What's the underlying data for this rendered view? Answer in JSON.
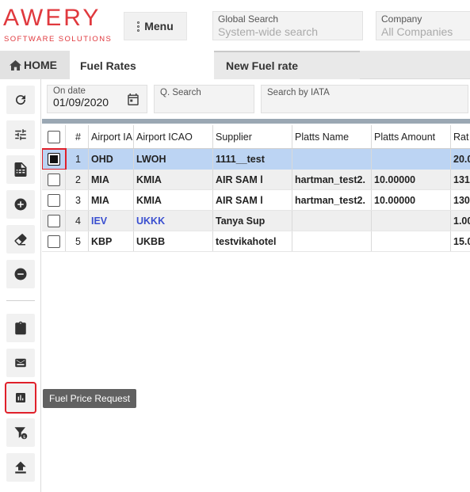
{
  "logo": {
    "main": "AWERY",
    "sub": "SOFTWARE SOLUTIONS"
  },
  "header": {
    "menu_label": "Menu",
    "global_search": {
      "label": "Global Search",
      "placeholder": "System-wide search"
    },
    "company": {
      "label": "Company",
      "placeholder": "All Companies"
    }
  },
  "tabs": [
    {
      "label": "HOME",
      "icon": "home-icon"
    },
    {
      "label": "Fuel Rates"
    },
    {
      "label": "New Fuel rate"
    }
  ],
  "sidebar": {
    "buttons": [
      {
        "name": "refresh",
        "icon": "refresh-icon"
      },
      {
        "name": "filters",
        "icon": "tune-icon"
      },
      {
        "name": "export",
        "icon": "spreadsheet-icon"
      },
      {
        "name": "add",
        "icon": "plus-circle-icon"
      },
      {
        "name": "clear",
        "icon": "eraser-icon"
      },
      {
        "name": "remove",
        "icon": "minus-circle-icon"
      },
      {
        "name": "clipboard",
        "icon": "clipboard-icon"
      },
      {
        "name": "email",
        "icon": "email-icon"
      },
      {
        "name": "fuel-price-request",
        "icon": "bar-chart-icon"
      },
      {
        "name": "filter-currency",
        "icon": "filter-dollar-icon"
      },
      {
        "name": "upload",
        "icon": "upload-icon"
      }
    ],
    "tooltip": "Fuel Price Request"
  },
  "filters": {
    "on_date": {
      "label": "On date",
      "value": "01/09/2020"
    },
    "q_search": {
      "placeholder": "Q. Search"
    },
    "iata_search": {
      "placeholder": "Search by IATA"
    }
  },
  "table": {
    "columns": [
      "#",
      "Airport IATA",
      "Airport ICAO",
      "Supplier",
      "Platts Name",
      "Platts Amount",
      "Rate"
    ],
    "header_display": [
      "#",
      "Airport IA",
      "Airport ICAO",
      "Supplier",
      "Platts Name",
      "Platts Amount",
      "Rat"
    ],
    "rows": [
      {
        "num": "1",
        "iata": "OHD",
        "icao": "LWOH",
        "supplier": "1111__test",
        "platts_name": "",
        "platts_amount": "",
        "rate": "20.0",
        "checked": true,
        "selected": true
      },
      {
        "num": "2",
        "iata": "MIA",
        "icao": "KMIA",
        "supplier": "AIR SAM l",
        "platts_name": "hartman_test2.",
        "platts_amount": "10.00000",
        "rate": "131",
        "checked": false,
        "selected": false
      },
      {
        "num": "3",
        "iata": "MIA",
        "icao": "KMIA",
        "supplier": "AIR SAM l",
        "platts_name": "hartman_test2.",
        "platts_amount": "10.00000",
        "rate": "130",
        "checked": false,
        "selected": false
      },
      {
        "num": "4",
        "iata": "IEV",
        "icao": "UKKK",
        "supplier": "Tanya Sup",
        "platts_name": "",
        "platts_amount": "",
        "rate": "1.00",
        "checked": false,
        "selected": false,
        "link": true
      },
      {
        "num": "5",
        "iata": "KBP",
        "icao": "UKBB",
        "supplier": "testvikahotel",
        "platts_name": "",
        "platts_amount": "",
        "rate": "15.0",
        "checked": false,
        "selected": false
      }
    ]
  },
  "colors": {
    "brand": "#e0393e",
    "selected_row": "#bcd4f3",
    "link": "#3a4fd0",
    "highlight": "#e0202a"
  }
}
